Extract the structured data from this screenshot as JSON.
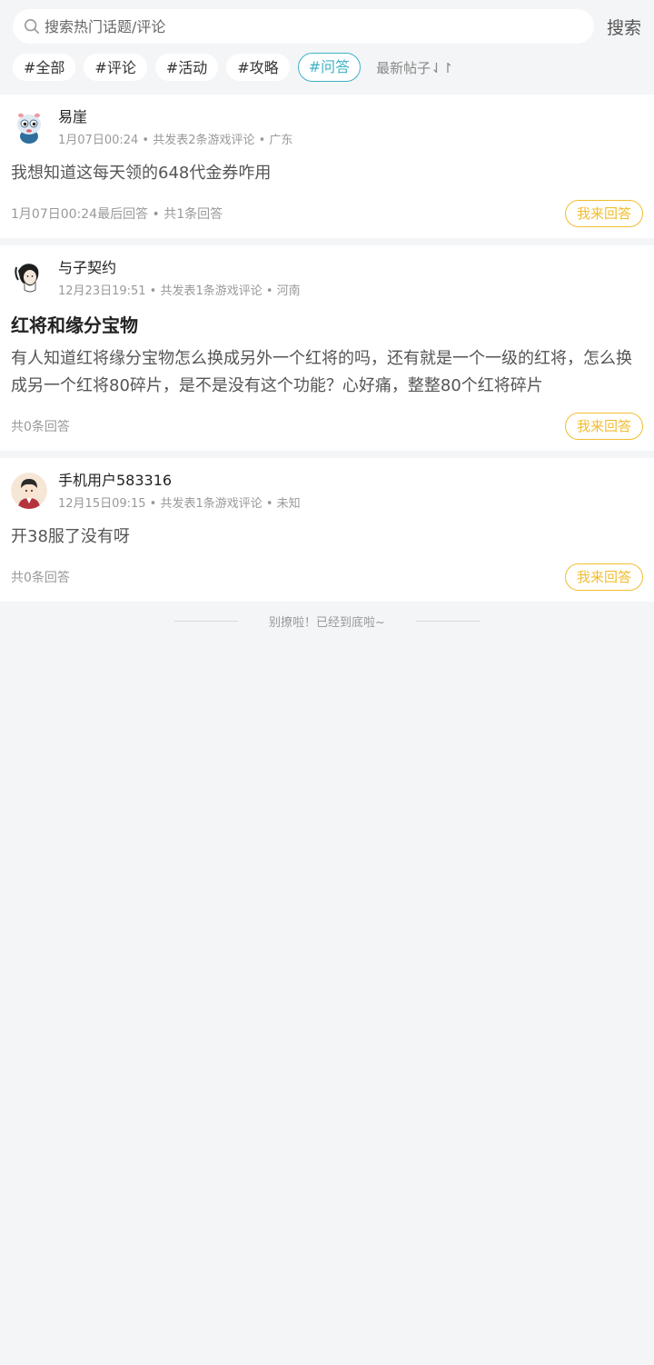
{
  "search": {
    "placeholder": "搜索热门话题/评论",
    "value": "",
    "button_label": "搜索"
  },
  "tags": [
    {
      "label": "#全部",
      "active": false
    },
    {
      "label": "#评论",
      "active": false
    },
    {
      "label": "#活动",
      "active": false
    },
    {
      "label": "#攻略",
      "active": false
    },
    {
      "label": "#问答",
      "active": true
    }
  ],
  "sort_label": "最新帖子⇃↾",
  "posts": [
    {
      "username": "易崖",
      "meta": "1月07日00:24 • 共发表2条游戏评论 • 广东",
      "title": "",
      "content": "我想知道这每天领的648代金券咋用",
      "footer": "1月07日00:24最后回答 • 共1条回答",
      "answer_label": "我来回答",
      "avatar": "mascot-avatar"
    },
    {
      "username": "与子契约",
      "meta": "12月23日19:51 • 共发表1条游戏评论 • 河南",
      "title": "红将和缘分宝物",
      "content": "有人知道红将缘分宝物怎么换成另外一个红将的吗，还有就是一个一级的红将，怎么换成另一个红将80碎片，是不是没有这个功能？心好痛，整整80个红将碎片",
      "footer": "共0条回答",
      "answer_label": "我来回答",
      "avatar": "ink-portrait-avatar"
    },
    {
      "username": "手机用户583316",
      "meta": "12月15日09:15 • 共发表1条游戏评论 • 未知",
      "title": "",
      "content": "开38服了没有呀",
      "footer": "共0条回答",
      "answer_label": "我来回答",
      "avatar": "cartoon-boy-avatar"
    }
  ],
  "end_text": "别撩啦！已经到底啦~",
  "colors": {
    "accent_teal": "#3fb3c6",
    "answer_yellow": "#f2bd31",
    "background": "#f4f5f7"
  }
}
